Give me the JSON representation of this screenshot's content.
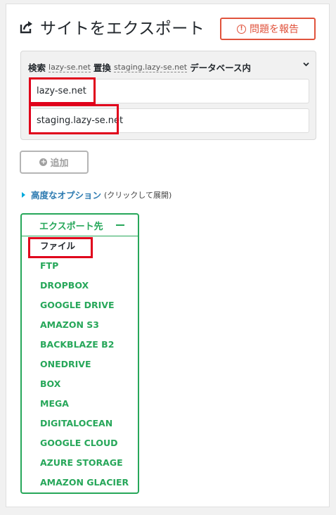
{
  "title": "サイトをエクスポート",
  "report_button": "問題を報告",
  "replace": {
    "search_label": "検索",
    "search_value": "lazy-se.net",
    "replace_label": "置換",
    "replace_value": "staging.lazy-se.net",
    "suffix": "データベース内",
    "find_input": "lazy-se.net",
    "replace_input": "staging.lazy-se.net"
  },
  "add_button": "追加",
  "advanced": {
    "link": "高度なオプション",
    "hint": "(クリックして展開)"
  },
  "export_to": {
    "header": "エクスポート先",
    "items": [
      "ファイル",
      "FTP",
      "DROPBOX",
      "GOOGLE DRIVE",
      "AMAZON S3",
      "BACKBLAZE B2",
      "ONEDRIVE",
      "BOX",
      "MEGA",
      "DIGITALOCEAN",
      "GOOGLE CLOUD",
      "AZURE STORAGE",
      "AMAZON GLACIER"
    ]
  },
  "colors": {
    "accent_green": "#27a75a",
    "highlight_red": "#e0001b",
    "report_red": "#e0533c",
    "link_blue": "#2e7bb1"
  }
}
